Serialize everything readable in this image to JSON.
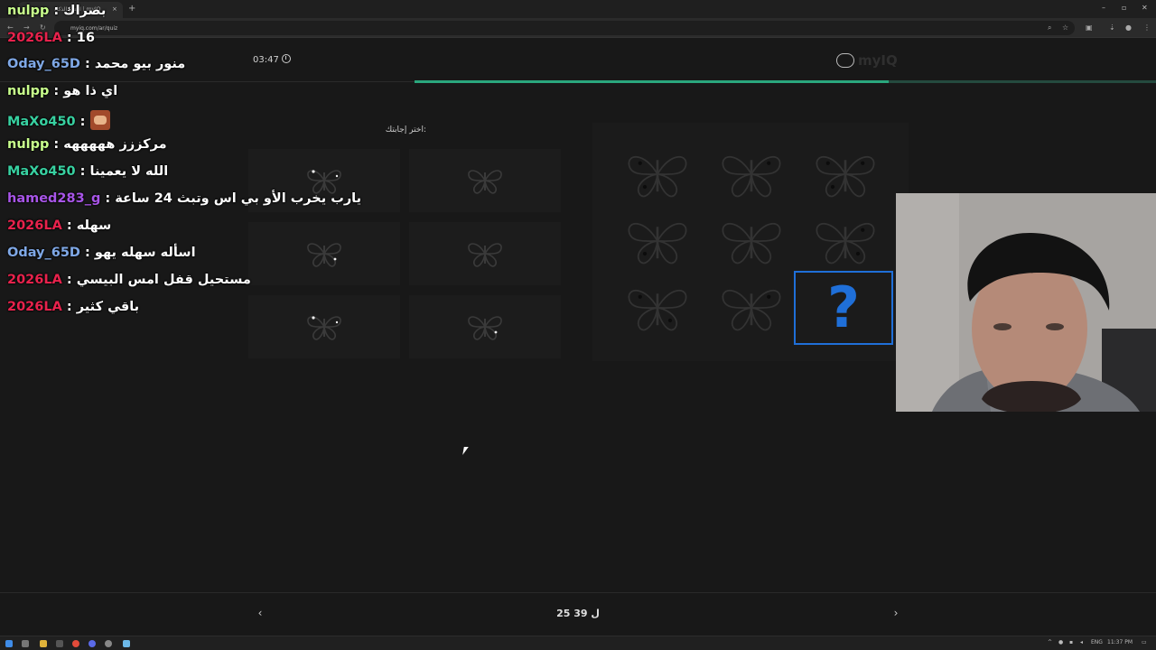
{
  "browser": {
    "tab_title": "اختبار الذكاء | myIQ",
    "url": "myiq.com/ar/quiz",
    "new_tab": "+",
    "tab_close": "×"
  },
  "quiz": {
    "timer": "03:47",
    "logo": "myIQ",
    "prompt": "اختر إجابتك:",
    "progress_fraction": 0.64,
    "pager": "25 ل 39",
    "prev_icon": "chevron-left-icon",
    "next_icon": "chevron-right-icon",
    "question_mark": "?"
  },
  "chat": [
    {
      "user": "nulpp",
      "color": "#c8ff8c",
      "text": "بصراك"
    },
    {
      "user": "2026LA",
      "color": "#e8224c",
      "text": "16"
    },
    {
      "user": "Oday_65D",
      "color": "#7fa8e6",
      "text": "منور بيو محمد"
    },
    {
      "user": "nulpp",
      "color": "#c8ff8c",
      "text": "اي ذا هو"
    },
    {
      "user": "MaXo450",
      "color": "#38d1a1",
      "text": "",
      "emote": true
    },
    {
      "user": "nulpp",
      "color": "#c8ff8c",
      "text": "مركززز هههههه"
    },
    {
      "user": "MaXo450",
      "color": "#38d1a1",
      "text": "الله لا يعمينا"
    },
    {
      "user": "hamed283_g",
      "color": "#a855e8",
      "text": "يارب يخرب الأو بي اس وتبث 24 ساعة"
    },
    {
      "user": "2026LA",
      "color": "#e8224c",
      "text": "سهله"
    },
    {
      "user": "Oday_65D",
      "color": "#7fa8e6",
      "text": "اسأله سهله يهو"
    },
    {
      "user": "2026LA",
      "color": "#e8224c",
      "text": "مستحيل قفل امس البيسي"
    },
    {
      "user": "2026LA",
      "color": "#e8224c",
      "text": "باقي كثير"
    }
  ],
  "taskbar": {
    "lang": "ENG",
    "time": "11:37 PM"
  },
  "colors": {
    "accent": "#2aa77d",
    "question_blue": "#1f6fd8"
  }
}
